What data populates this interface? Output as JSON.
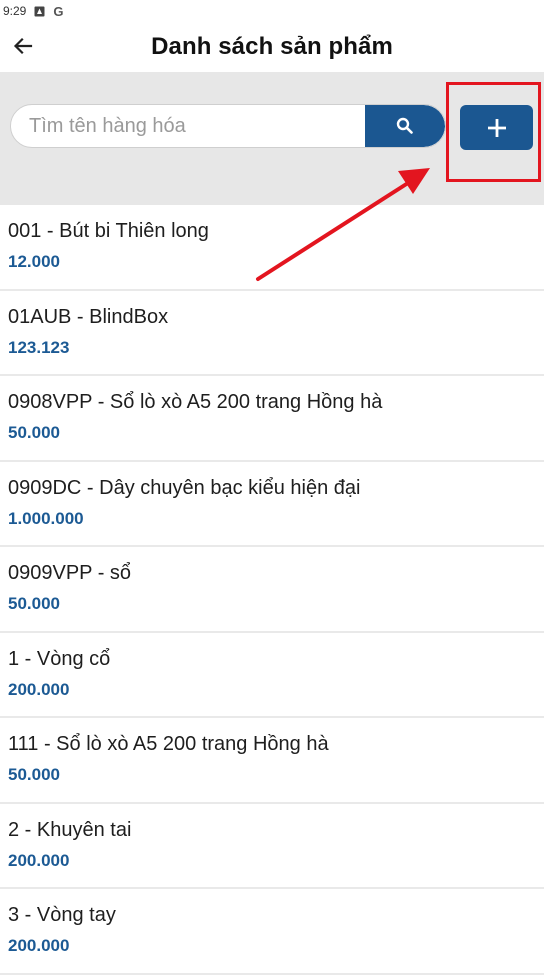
{
  "status_bar": {
    "time": "9:29",
    "icons": [
      "notification-icon",
      "google-icon"
    ],
    "google_letter": "G"
  },
  "header": {
    "title": "Danh sách sản phẩm",
    "back_icon": "arrow-left-icon"
  },
  "search": {
    "placeholder": "Tìm tên hàng hóa",
    "value": "",
    "button_icon": "search-icon"
  },
  "add_button": {
    "icon": "plus-icon"
  },
  "annotation": {
    "color": "#e3151f"
  },
  "colors": {
    "accent": "#1b5791",
    "price": "#1c5a94",
    "search_band": "#e7e7e7"
  },
  "products": [
    {
      "name": "001 - Bút bi Thiên long",
      "price": "12.000"
    },
    {
      "name": "01AUB - BlindBox",
      "price": "123.123"
    },
    {
      "name": "0908VPP - Sổ lò xò A5 200 trang Hồng hà",
      "price": "50.000"
    },
    {
      "name": "0909DC - Dây chuyên bạc kiểu hiện đại",
      "price": "1.000.000"
    },
    {
      "name": "0909VPP - sổ",
      "price": "50.000"
    },
    {
      "name": "1 - Vòng cổ",
      "price": "200.000"
    },
    {
      "name": "111 - Sổ lò xò A5 200 trang Hồng hà",
      "price": "50.000"
    },
    {
      "name": "2 - Khuyên tai",
      "price": "200.000"
    },
    {
      "name": "3 - Vòng tay",
      "price": "200.000"
    }
  ]
}
